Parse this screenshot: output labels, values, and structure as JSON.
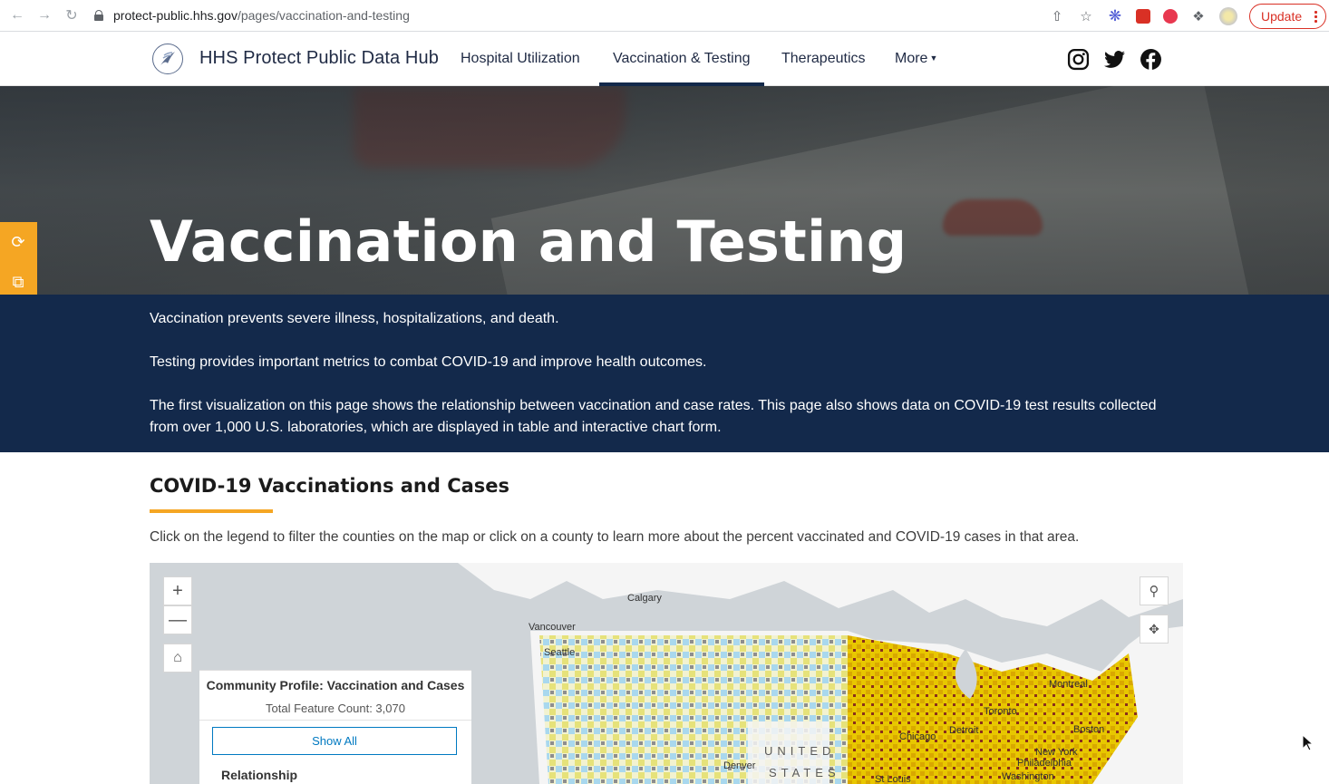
{
  "browser": {
    "url_host": "protect-public.hhs.gov",
    "url_path": "/pages/vaccination-and-testing",
    "update_label": "Update"
  },
  "header": {
    "site_title": "HHS Protect Public Data Hub",
    "nav": [
      {
        "label": "Hospital Utilization"
      },
      {
        "label": "Vaccination & Testing",
        "active": true
      },
      {
        "label": "Therapeutics"
      },
      {
        "label": "More"
      }
    ],
    "social": [
      "instagram-icon",
      "twitter-icon",
      "facebook-icon"
    ]
  },
  "hero": {
    "title": "Vaccination and Testing"
  },
  "intro": {
    "p1": "Vaccination prevents severe illness, hospitalizations, and death.",
    "p2": "Testing provides important metrics to combat COVID-19 and improve health outcomes.",
    "p3": "The first visualization on this page shows the relationship between vaccination and case rates. This page also shows data on COVID-19 test results collected from over 1,000 U.S. laboratories, which are displayed in table and interactive chart form."
  },
  "section": {
    "title": "COVID-19 Vaccinations and Cases",
    "description": "Click on the legend to filter the counties on the map or click on a county to learn more about the percent vaccinated and COVID-19 cases in that area."
  },
  "map": {
    "legend_title": "Community Profile: Vaccination and Cases",
    "legend_count": "Total Feature Count: 3,070",
    "show_all": "Show All",
    "relationship": "Relationship",
    "cities": {
      "calgary": "Calgary",
      "vancouver": "Vancouver",
      "seattle": "Seattle",
      "montreal": "Montreal",
      "toronto": "Toronto",
      "detroit": "Detroit",
      "chicago": "Chicago",
      "boston": "Boston",
      "new_york": "New York",
      "philadelphia": "Philadelphia",
      "washington": "Washington",
      "denver": "Denver",
      "st_louis": "St Louis"
    },
    "country_label_1": "UNITED",
    "country_label_2": "STATES"
  },
  "colors": {
    "navy": "#13294b",
    "accent": "#f5a623",
    "link": "#0079c1"
  }
}
